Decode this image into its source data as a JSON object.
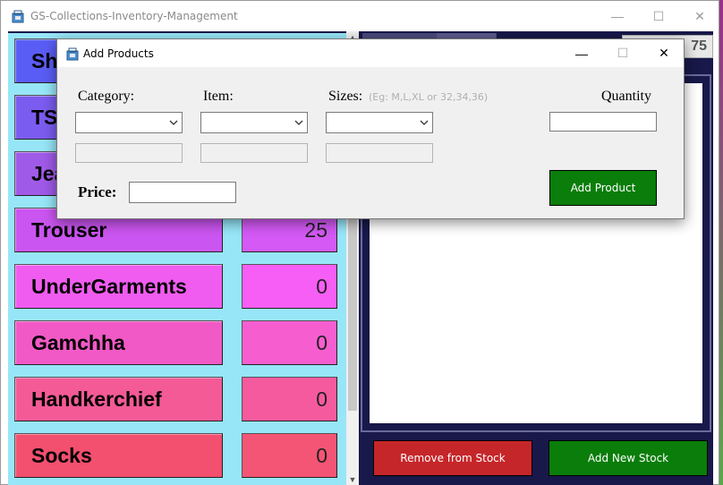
{
  "main_window": {
    "title": "GS-Collections-Inventory-Management",
    "controls": {
      "minimize": "—",
      "maximize": "☐",
      "close": "✕"
    }
  },
  "categories": [
    {
      "label": "Sh",
      "count": "",
      "color": "#5a5df5",
      "count_color": "#7a86f8"
    },
    {
      "label": "TS",
      "count": "",
      "color": "#7b5cf0",
      "count_color": "#8d74f3"
    },
    {
      "label": "Jea",
      "count": "",
      "color": "#a05ae8",
      "count_color": "#b06ef0"
    },
    {
      "label": "Trouser",
      "count": "25",
      "color": "#cb55f1",
      "count_color": "#d459f5"
    },
    {
      "label": "UnderGarments",
      "count": "0",
      "color": "#f05cf0",
      "count_color": "#f75ef5"
    },
    {
      "label": "Gamchha",
      "count": "0",
      "color": "#f159c6",
      "count_color": "#f65ed0"
    },
    {
      "label": "Handkerchief",
      "count": "0",
      "color": "#f45a96",
      "count_color": "#f65a9e"
    },
    {
      "label": "Socks",
      "count": "0",
      "color": "#f34f6e",
      "count_color": "#f55574"
    }
  ],
  "stock_total": "75",
  "buttons": {
    "remove_from_stock": "Remove from Stock",
    "add_new_stock": "Add New Stock"
  },
  "dialog": {
    "title": "Add Products",
    "controls": {
      "minimize": "—",
      "maximize": "☐",
      "close": "✕"
    },
    "labels": {
      "category": "Category:",
      "item": "Item:",
      "sizes": "Sizes:",
      "sizes_hint": "(Eg: M,L,XL or 32,34,36)",
      "quantity": "Quantity",
      "price": "Price:"
    },
    "fields": {
      "category_value": "",
      "item_value": "",
      "sizes_value": "",
      "quantity_value": "",
      "price_value": ""
    },
    "add_product_label": "Add Product"
  },
  "colors": {
    "left_panel_bg": "#97e6f8",
    "client_bg": "#18184a",
    "remove_btn": "#c5262a",
    "add_btn": "#0a7d0a"
  }
}
